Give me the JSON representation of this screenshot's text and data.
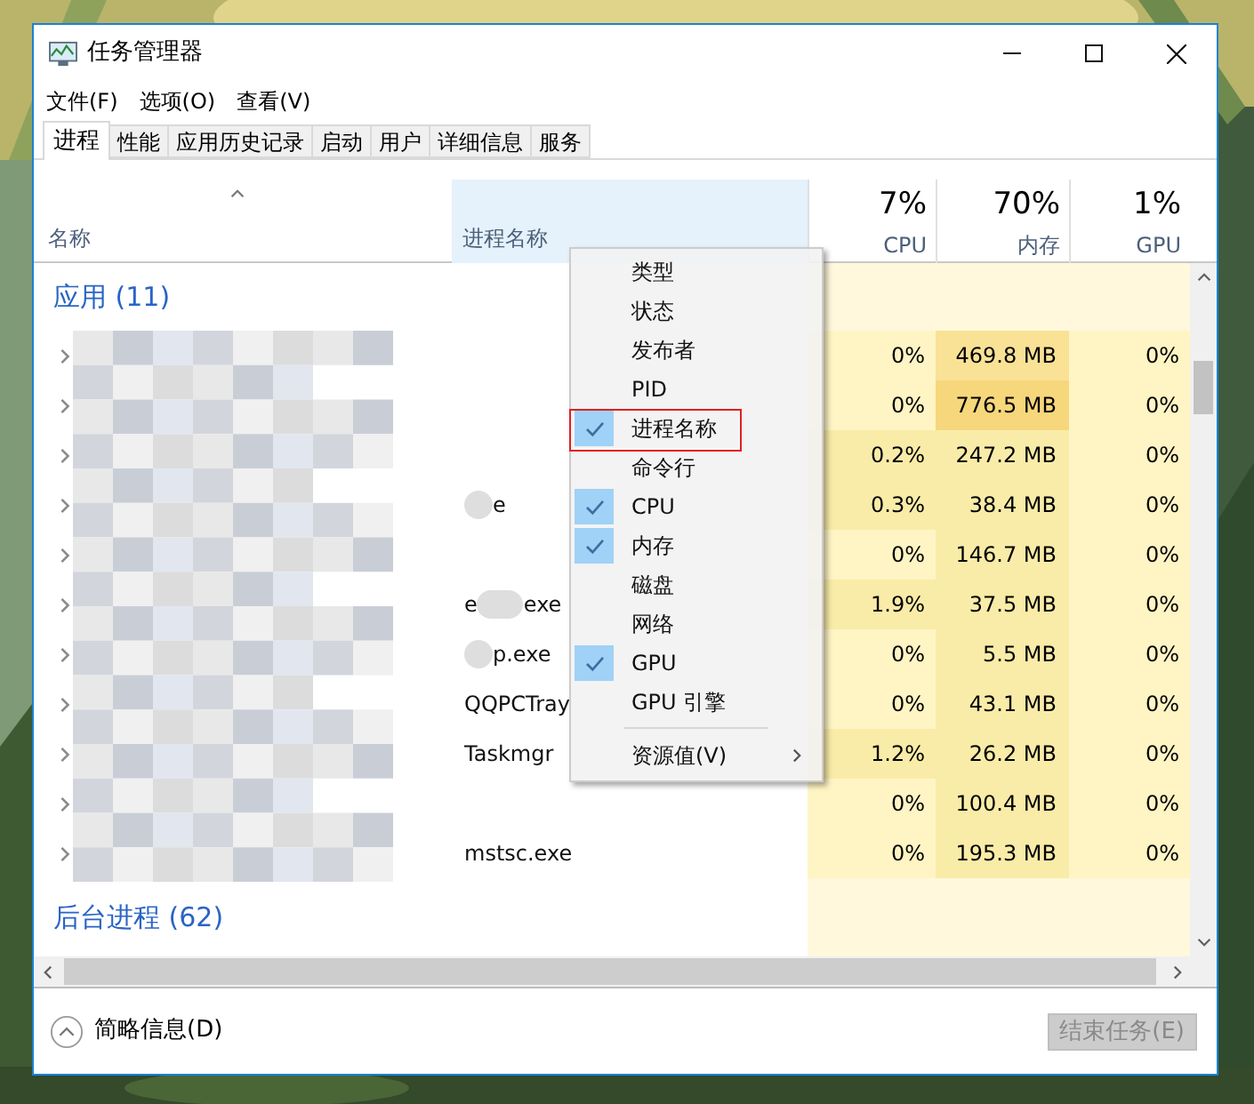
{
  "window": {
    "title": "任务管理器"
  },
  "menu": [
    "文件(F)",
    "选项(O)",
    "查看(V)"
  ],
  "tabs": [
    {
      "label": "进程",
      "selected": true
    },
    {
      "label": "性能",
      "selected": false
    },
    {
      "label": "应用历史记录",
      "selected": false
    },
    {
      "label": "启动",
      "selected": false
    },
    {
      "label": "用户",
      "selected": false
    },
    {
      "label": "详细信息",
      "selected": false
    },
    {
      "label": "服务",
      "selected": false
    }
  ],
  "columns": {
    "name": "名称",
    "process_name": "进程名称",
    "cpu": {
      "percent": "7%",
      "label": "CPU"
    },
    "memory": {
      "percent": "70%",
      "label": "内存"
    },
    "gpu": {
      "percent": "1%",
      "label": "GPU"
    }
  },
  "groups": [
    {
      "title": "应用 (11)",
      "rows": [
        {
          "process_name": [],
          "cpu": {
            "text": "0%",
            "color": "#fff4c4"
          },
          "memory": {
            "text": "469.8 MB",
            "color": "#f9e296"
          },
          "gpu": "0%"
        },
        {
          "process_name": [],
          "cpu": {
            "text": "0%",
            "color": "#fff4c4"
          },
          "memory": {
            "text": "776.5 MB",
            "color": "#f7d77c"
          },
          "gpu": "0%"
        },
        {
          "process_name": [],
          "cpu": {
            "text": "0.2%",
            "color": "#f9eca8"
          },
          "memory": {
            "text": "247.2 MB",
            "color": "#f9eca8"
          },
          "gpu": "0%"
        },
        {
          "process_name": [
            {
              "kind": "blur"
            },
            {
              "kind": "text",
              "text": "e"
            }
          ],
          "cpu": {
            "text": "0.3%",
            "color": "#f9eca8"
          },
          "memory": {
            "text": "38.4 MB",
            "color": "#f9eca8"
          },
          "gpu": "0%"
        },
        {
          "process_name": [],
          "cpu": {
            "text": "0%",
            "color": "#fff4c4"
          },
          "memory": {
            "text": "146.7 MB",
            "color": "#f9eca8"
          },
          "gpu": "0%"
        },
        {
          "process_name": [
            {
              "kind": "text",
              "text": "e"
            },
            {
              "kind": "blur"
            },
            {
              "kind": "text",
              "text": "exe"
            }
          ],
          "cpu": {
            "text": "1.9%",
            "color": "#f9eca8"
          },
          "memory": {
            "text": "37.5 MB",
            "color": "#f9eca8"
          },
          "gpu": "0%"
        },
        {
          "process_name": [
            {
              "kind": "blur"
            },
            {
              "kind": "text",
              "text": "p.exe"
            }
          ],
          "cpu": {
            "text": "0%",
            "color": "#fff4c4"
          },
          "memory": {
            "text": "5.5 MB",
            "color": "#f9eca8"
          },
          "gpu": "0%"
        },
        {
          "process_name": [
            {
              "kind": "text",
              "text": "QQPCTray"
            }
          ],
          "cpu": {
            "text": "0%",
            "color": "#fff4c4"
          },
          "memory": {
            "text": "43.1 MB",
            "color": "#f9eca8"
          },
          "gpu": "0%"
        },
        {
          "process_name": [
            {
              "kind": "text",
              "text": "Taskmgr"
            }
          ],
          "cpu": {
            "text": "1.2%",
            "color": "#f9eca8"
          },
          "memory": {
            "text": "26.2 MB",
            "color": "#f9eca8"
          },
          "gpu": "0%"
        },
        {
          "process_name": [],
          "cpu": {
            "text": "0%",
            "color": "#fff4c4"
          },
          "memory": {
            "text": "100.4 MB",
            "color": "#f9eca8"
          },
          "gpu": "0%"
        },
        {
          "process_name": [
            {
              "kind": "text",
              "text": "mstsc.exe"
            }
          ],
          "cpu": {
            "text": "0%",
            "color": "#fff4c4"
          },
          "memory": {
            "text": "195.3 MB",
            "color": "#f9eca8"
          },
          "gpu": "0%"
        }
      ]
    },
    {
      "title": "后台进程 (62)"
    }
  ],
  "context_menu": [
    {
      "label": "类型",
      "checked": false,
      "annotated": false
    },
    {
      "label": "状态",
      "checked": false,
      "annotated": false
    },
    {
      "label": "发布者",
      "checked": false,
      "annotated": false
    },
    {
      "label": "PID",
      "checked": false,
      "annotated": false
    },
    {
      "label": "进程名称",
      "checked": true,
      "annotated": true
    },
    {
      "label": "命令行",
      "checked": false,
      "annotated": false
    },
    {
      "label": "CPU",
      "checked": true,
      "annotated": false
    },
    {
      "label": "内存",
      "checked": true,
      "annotated": false
    },
    {
      "label": "磁盘",
      "checked": false,
      "annotated": false
    },
    {
      "label": "网络",
      "checked": false,
      "annotated": false
    },
    {
      "label": "GPU",
      "checked": true,
      "annotated": false
    },
    {
      "label": "GPU 引擎",
      "checked": false,
      "annotated": false
    }
  ],
  "context_submenu": {
    "label": "资源值(V)"
  },
  "footer": {
    "details_toggle": "简略信息(D)",
    "end_task": {
      "label": "结束任务(E)",
      "disabled": true
    }
  }
}
